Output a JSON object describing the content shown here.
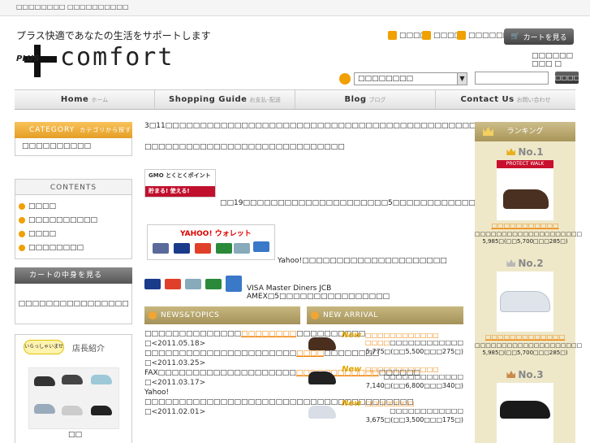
{
  "header": {
    "top_tiny": "□□□□□□□□ □□□□□□□□□□",
    "tagline": "プラス快適であなたの生活をサポートします",
    "logo_plus": "PLUS",
    "logo_word": "comfort",
    "util_links": [
      "□□□□",
      "□□□□",
      "□□□□□□□□"
    ],
    "cart_button": "カートを見る",
    "cart_status": "□□□□□□ □□□ □",
    "search_select": "□□□□□□□□",
    "search_button": "□□□□"
  },
  "nav": [
    {
      "label": "Home",
      "sub": "ホーム"
    },
    {
      "label": "Shopping Guide",
      "sub": "お支払･配送"
    },
    {
      "label": "Blog",
      "sub": "ブログ"
    },
    {
      "label": "Contact Us",
      "sub": "お問い合わせ"
    }
  ],
  "sidebar": {
    "category_title": "CATEGORY",
    "category_sub": "カテゴリから探す",
    "category_item": "□□□□□□□□□□",
    "contents_title": "CONTENTS",
    "contents_items": [
      "□□□□",
      "□□□□□□□□□□",
      "□□□□",
      "□□□□□□□□"
    ],
    "cart_title": "カートの中身を見る",
    "cart_body": "□□□□□□□□□□□□□□□□",
    "manager_badge": "いらっしゃいませ",
    "manager_title": "店長紹介",
    "manager_caption": "□□"
  },
  "main": {
    "p1": "3□11□□□□□□□□□□□□□□□□□□□□□□□□□□□□□□□□□□□□□□□□□□□□□□□□□□□□",
    "p2": "□□□□□□□□□□□□□□□□□□□□□□□□□□□□□",
    "gmo_top": "GMO とくとくポイント",
    "gmo_bottom": "貯まる! 使える!",
    "gmo_text": "□□19□□□□□□□□□□□□□□□□□□□□□5□□□□□□□□□□□□□□□□□□□□",
    "yahoo_logo": "YAHOO! ウォレット",
    "yahoo_text": "Yahoo!□□□□□□□□□□□□□□□□□□□□□",
    "cards_text": "VISA Master Diners JCB AMEX□5□□□□□□□□□□□□□□□□"
  },
  "news": {
    "title": "NEWS&TOPICS",
    "items": [
      {
        "pre": "□□□□□□□□□□□□□□",
        "link": "□□□□□□□□",
        "post": "□□□□□□□□□□",
        "date": "□<2011.05.18>"
      },
      {
        "pre": "□□□□□□□□□□□□□□□□□□□□□□",
        "link": "□□□□",
        "post": "□□□□□□□□",
        "date": "□<2011.03.25>"
      },
      {
        "pre": "FAX□□□□□□□□□□□□□□□□□□□□",
        "link": "□□□□□□□□□□□□",
        "post": "□□□□□□",
        "date": "□<2011.03.17>"
      },
      {
        "pre": "Yahoo!□□□□□□□□□□□□□□□□□□□□□□□□□□□□□□□□□□□□□□□",
        "link": "",
        "post": "",
        "date": "□<2011.02.01>"
      }
    ]
  },
  "arrival": {
    "title": "NEW ARRIVAL",
    "items": [
      {
        "badge": "New",
        "name": "□□□□□□□□□□□□ □□□□",
        "brand": "□□□□□□□□□□□□",
        "price": "5,775□(□□5,500□□□275□)"
      },
      {
        "badge": "New",
        "name": "□□□□□□□□□□□□",
        "brand": "□□□□□□□□□□□□□",
        "price": "7,140□(□□6,800□□□340□)"
      },
      {
        "badge": "New",
        "name": "□□□□□□□□",
        "brand": "□□□□□□□□□□□□",
        "price": "3,675□(□□3,500□□□175□)"
      }
    ]
  },
  "ranking": {
    "title": "ランキング",
    "items": [
      {
        "no": "No.1",
        "name": "□□□□□□□□□□□",
        "desc": "□□□□□□□□□□□□□□□□□□□□",
        "price": "5,985□(□□5,700□□□285□)",
        "img_label": "PROTECT WALK",
        "crown": "#e8b020"
      },
      {
        "no": "No.2",
        "name": "□□□□□□□□□□□□□",
        "desc": "□□□□□□□□□□□□□□□□□□□□",
        "price": "5,985□(□□5,700□□□285□)",
        "img_label": "",
        "crown": "#b8b8b8"
      },
      {
        "no": "No.3",
        "name": "",
        "desc": "",
        "price": "",
        "img_label": "",
        "crown": "#c98a4a"
      }
    ]
  },
  "colors": {
    "accent": "#f08000",
    "nav_bg": "#e6e6e6",
    "rank_bg": "#eee8c9"
  }
}
